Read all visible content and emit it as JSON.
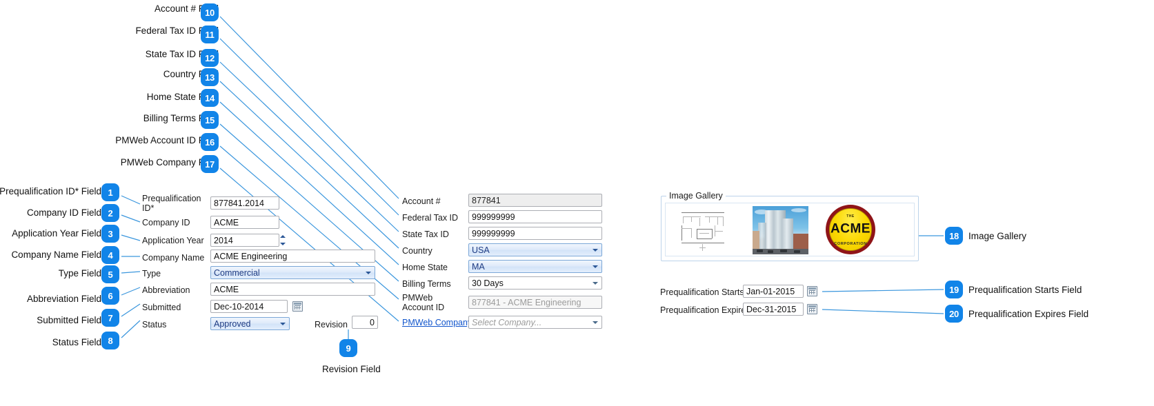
{
  "callouts": [
    {
      "n": "1",
      "label": "Prequalification ID* Field"
    },
    {
      "n": "2",
      "label": "Company ID Field"
    },
    {
      "n": "3",
      "label": "Application Year Field"
    },
    {
      "n": "4",
      "label": "Company Name Field"
    },
    {
      "n": "5",
      "label": "Type Field"
    },
    {
      "n": "6",
      "label": "Abbreviation Field"
    },
    {
      "n": "7",
      "label": "Submitted Field"
    },
    {
      "n": "8",
      "label": "Status Field"
    },
    {
      "n": "9",
      "label": "Revision Field"
    },
    {
      "n": "10",
      "label": "Account # Field"
    },
    {
      "n": "11",
      "label": "Federal Tax ID Field"
    },
    {
      "n": "12",
      "label": "State Tax ID Field"
    },
    {
      "n": "13",
      "label": "Country Field"
    },
    {
      "n": "14",
      "label": "Home State Field"
    },
    {
      "n": "15",
      "label": "Billing Terms Field"
    },
    {
      "n": "16",
      "label": "PMWeb Account ID Field"
    },
    {
      "n": "17",
      "label": "PMWeb Company Field"
    },
    {
      "n": "18",
      "label": "Image Gallery"
    },
    {
      "n": "19",
      "label": "Prequalification Starts Field"
    },
    {
      "n": "20",
      "label": "Prequalification Expires Field"
    }
  ],
  "form": {
    "left": {
      "prequalification_id": {
        "label": "Prequalification ID*",
        "value": "877841.2014"
      },
      "company_id": {
        "label": "Company ID",
        "value": "ACME"
      },
      "application_year": {
        "label": "Application Year",
        "value": "2014"
      },
      "company_name": {
        "label": "Company Name",
        "value": "ACME Engineering"
      },
      "type": {
        "label": "Type",
        "value": "Commercial"
      },
      "abbreviation": {
        "label": "Abbreviation",
        "value": "ACME"
      },
      "submitted": {
        "label": "Submitted",
        "value": "Dec-10-2014"
      },
      "status": {
        "label": "Status",
        "value": "Approved"
      },
      "revision": {
        "label": "Revision",
        "value": "0"
      }
    },
    "middle": {
      "account_number": {
        "label": "Account #",
        "value": "877841"
      },
      "federal_tax_id": {
        "label": "Federal Tax ID",
        "value": "999999999"
      },
      "state_tax_id": {
        "label": "State Tax ID",
        "value": "999999999"
      },
      "country": {
        "label": "Country",
        "value": "USA"
      },
      "home_state": {
        "label": "Home State",
        "value": "MA"
      },
      "billing_terms": {
        "label": "Billing Terms",
        "value": "30 Days"
      },
      "pmweb_account_id": {
        "label": "PMWeb Account ID",
        "value": "877841 - ACME Engineering"
      },
      "pmweb_company": {
        "label": "PMWeb Company",
        "placeholder": "Select Company..."
      }
    },
    "right": {
      "gallery_legend": "Image Gallery",
      "prequalification_starts": {
        "label": "Prequalification Starts",
        "value": "Jan-01-2015"
      },
      "prequalification_expires": {
        "label": "Prequalification Expires",
        "value": "Dec-31-2015"
      }
    }
  },
  "gallery": {
    "logo": {
      "top_text": "THE",
      "main_text": "ACME",
      "bottom_text": "CORPORATION"
    }
  },
  "colors": {
    "badge": "#1184e8",
    "leader": "#3a96dd",
    "link": "#1155cc",
    "combo_text": "#1f3c83"
  }
}
